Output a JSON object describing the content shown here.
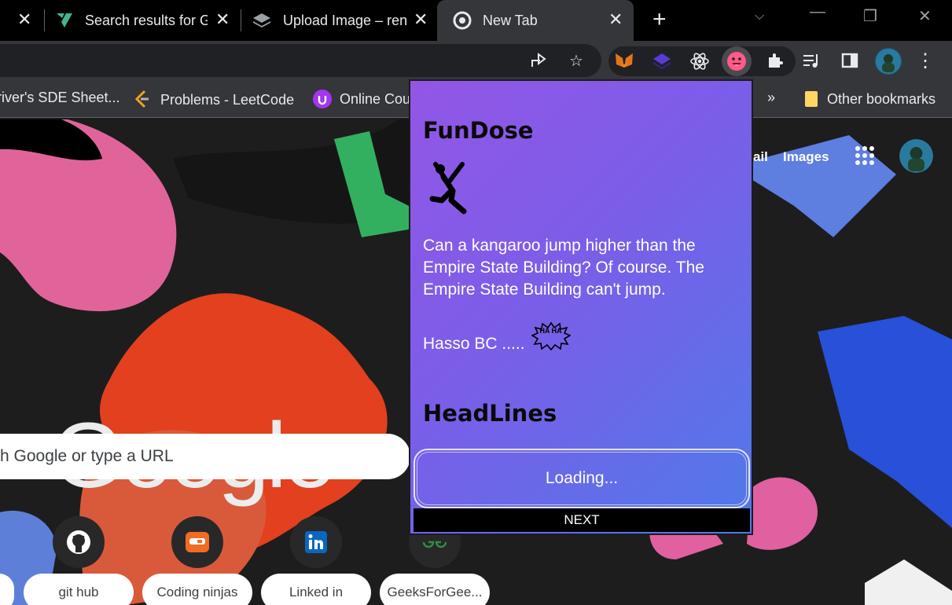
{
  "tabs": [
    {
      "title": "",
      "active": false
    },
    {
      "title": "Search results for G",
      "active": false
    },
    {
      "title": "Upload Image – ren",
      "active": false
    },
    {
      "title": "New Tab",
      "active": true
    }
  ],
  "toolbar": {
    "share_icon": "share-icon",
    "star_icon": "star-icon",
    "extensions": [
      "metamask-icon",
      "layers-extension-icon",
      "react-devtools-icon",
      "fundose-emoji-icon"
    ],
    "puzzle_icon": "puzzle-icon",
    "media_icon": "media-controls-icon",
    "sidepanel_icon": "side-panel-icon",
    "menu_icon": "kebab-menu-icon"
  },
  "bookmarks": [
    {
      "label": "river's SDE Sheet..."
    },
    {
      "label": "Problems - LeetCode"
    },
    {
      "label": "Online Cou"
    },
    {
      "label": "»"
    },
    {
      "label": "Other bookmarks"
    }
  ],
  "ntp": {
    "gmail_label": "ail",
    "images_label": "Images",
    "logo_text": "Google",
    "search_placeholder": "h Google or type a URL",
    "shortcuts": [
      {
        "label": "git hub",
        "icon": "github-icon"
      },
      {
        "label": "Coding ninjas",
        "icon": "coding-ninjas-icon"
      },
      {
        "label": "Linked in",
        "icon": "linkedin-icon"
      },
      {
        "label": "GeeksForGee...",
        "icon": "gfg-icon"
      }
    ]
  },
  "popup": {
    "title": "FunDose",
    "joke": "Can a kangaroo jump higher than the Empire State Building? Of course. The Empire State Building can't jump.",
    "sign_off": "Hasso BC .....",
    "haha_text": "HA HA",
    "headlines_title": "HeadLines",
    "loading_label": "Loading...",
    "next_label": "NEXT"
  }
}
